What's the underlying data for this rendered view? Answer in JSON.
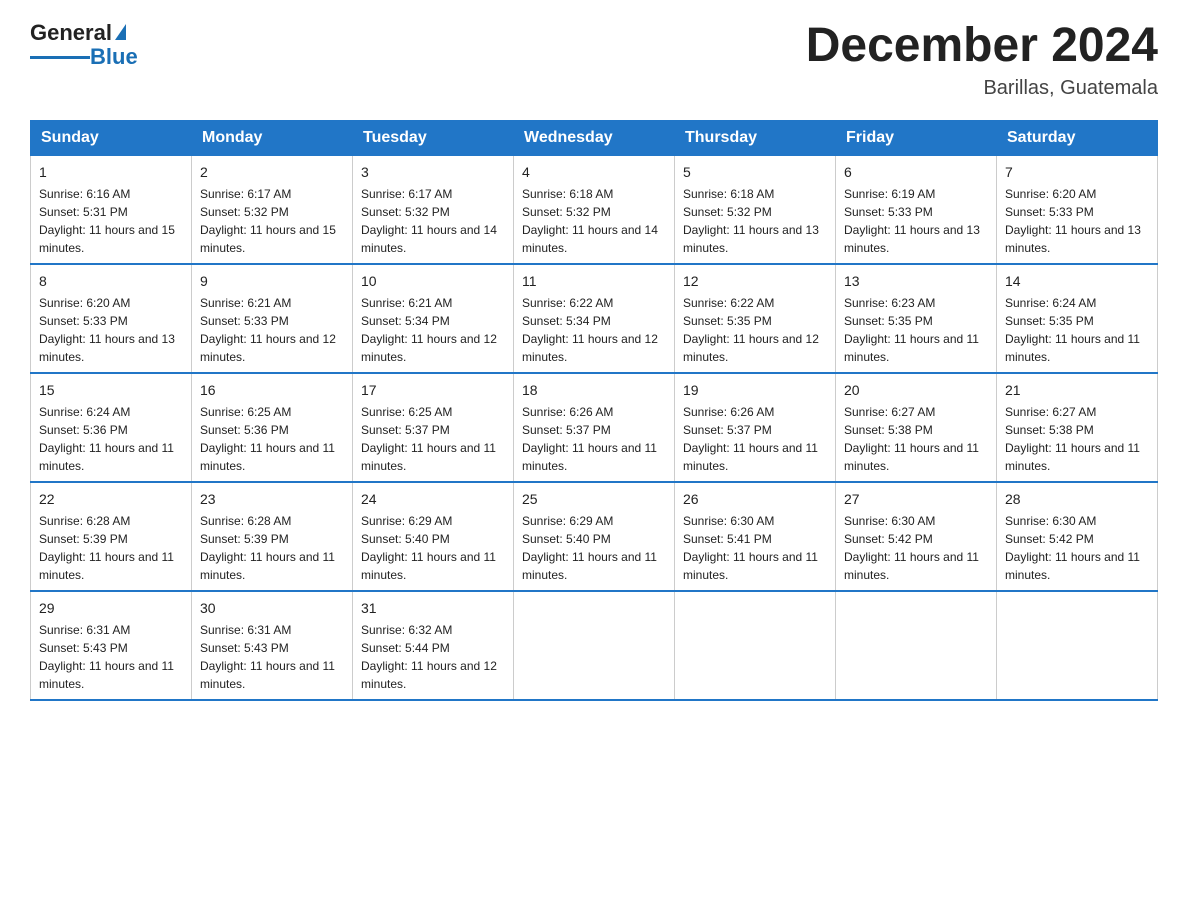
{
  "header": {
    "logo_general": "General",
    "logo_blue": "Blue",
    "month_title": "December 2024",
    "location": "Barillas, Guatemala"
  },
  "days_of_week": [
    "Sunday",
    "Monday",
    "Tuesday",
    "Wednesday",
    "Thursday",
    "Friday",
    "Saturday"
  ],
  "weeks": [
    [
      {
        "day": "1",
        "sunrise": "6:16 AM",
        "sunset": "5:31 PM",
        "daylight": "11 hours and 15 minutes."
      },
      {
        "day": "2",
        "sunrise": "6:17 AM",
        "sunset": "5:32 PM",
        "daylight": "11 hours and 15 minutes."
      },
      {
        "day": "3",
        "sunrise": "6:17 AM",
        "sunset": "5:32 PM",
        "daylight": "11 hours and 14 minutes."
      },
      {
        "day": "4",
        "sunrise": "6:18 AM",
        "sunset": "5:32 PM",
        "daylight": "11 hours and 14 minutes."
      },
      {
        "day": "5",
        "sunrise": "6:18 AM",
        "sunset": "5:32 PM",
        "daylight": "11 hours and 13 minutes."
      },
      {
        "day": "6",
        "sunrise": "6:19 AM",
        "sunset": "5:33 PM",
        "daylight": "11 hours and 13 minutes."
      },
      {
        "day": "7",
        "sunrise": "6:20 AM",
        "sunset": "5:33 PM",
        "daylight": "11 hours and 13 minutes."
      }
    ],
    [
      {
        "day": "8",
        "sunrise": "6:20 AM",
        "sunset": "5:33 PM",
        "daylight": "11 hours and 13 minutes."
      },
      {
        "day": "9",
        "sunrise": "6:21 AM",
        "sunset": "5:33 PM",
        "daylight": "11 hours and 12 minutes."
      },
      {
        "day": "10",
        "sunrise": "6:21 AM",
        "sunset": "5:34 PM",
        "daylight": "11 hours and 12 minutes."
      },
      {
        "day": "11",
        "sunrise": "6:22 AM",
        "sunset": "5:34 PM",
        "daylight": "11 hours and 12 minutes."
      },
      {
        "day": "12",
        "sunrise": "6:22 AM",
        "sunset": "5:35 PM",
        "daylight": "11 hours and 12 minutes."
      },
      {
        "day": "13",
        "sunrise": "6:23 AM",
        "sunset": "5:35 PM",
        "daylight": "11 hours and 11 minutes."
      },
      {
        "day": "14",
        "sunrise": "6:24 AM",
        "sunset": "5:35 PM",
        "daylight": "11 hours and 11 minutes."
      }
    ],
    [
      {
        "day": "15",
        "sunrise": "6:24 AM",
        "sunset": "5:36 PM",
        "daylight": "11 hours and 11 minutes."
      },
      {
        "day": "16",
        "sunrise": "6:25 AM",
        "sunset": "5:36 PM",
        "daylight": "11 hours and 11 minutes."
      },
      {
        "day": "17",
        "sunrise": "6:25 AM",
        "sunset": "5:37 PM",
        "daylight": "11 hours and 11 minutes."
      },
      {
        "day": "18",
        "sunrise": "6:26 AM",
        "sunset": "5:37 PM",
        "daylight": "11 hours and 11 minutes."
      },
      {
        "day": "19",
        "sunrise": "6:26 AM",
        "sunset": "5:37 PM",
        "daylight": "11 hours and 11 minutes."
      },
      {
        "day": "20",
        "sunrise": "6:27 AM",
        "sunset": "5:38 PM",
        "daylight": "11 hours and 11 minutes."
      },
      {
        "day": "21",
        "sunrise": "6:27 AM",
        "sunset": "5:38 PM",
        "daylight": "11 hours and 11 minutes."
      }
    ],
    [
      {
        "day": "22",
        "sunrise": "6:28 AM",
        "sunset": "5:39 PM",
        "daylight": "11 hours and 11 minutes."
      },
      {
        "day": "23",
        "sunrise": "6:28 AM",
        "sunset": "5:39 PM",
        "daylight": "11 hours and 11 minutes."
      },
      {
        "day": "24",
        "sunrise": "6:29 AM",
        "sunset": "5:40 PM",
        "daylight": "11 hours and 11 minutes."
      },
      {
        "day": "25",
        "sunrise": "6:29 AM",
        "sunset": "5:40 PM",
        "daylight": "11 hours and 11 minutes."
      },
      {
        "day": "26",
        "sunrise": "6:30 AM",
        "sunset": "5:41 PM",
        "daylight": "11 hours and 11 minutes."
      },
      {
        "day": "27",
        "sunrise": "6:30 AM",
        "sunset": "5:42 PM",
        "daylight": "11 hours and 11 minutes."
      },
      {
        "day": "28",
        "sunrise": "6:30 AM",
        "sunset": "5:42 PM",
        "daylight": "11 hours and 11 minutes."
      }
    ],
    [
      {
        "day": "29",
        "sunrise": "6:31 AM",
        "sunset": "5:43 PM",
        "daylight": "11 hours and 11 minutes."
      },
      {
        "day": "30",
        "sunrise": "6:31 AM",
        "sunset": "5:43 PM",
        "daylight": "11 hours and 11 minutes."
      },
      {
        "day": "31",
        "sunrise": "6:32 AM",
        "sunset": "5:44 PM",
        "daylight": "11 hours and 12 minutes."
      },
      null,
      null,
      null,
      null
    ]
  ],
  "labels": {
    "sunrise": "Sunrise:",
    "sunset": "Sunset:",
    "daylight": "Daylight:"
  }
}
